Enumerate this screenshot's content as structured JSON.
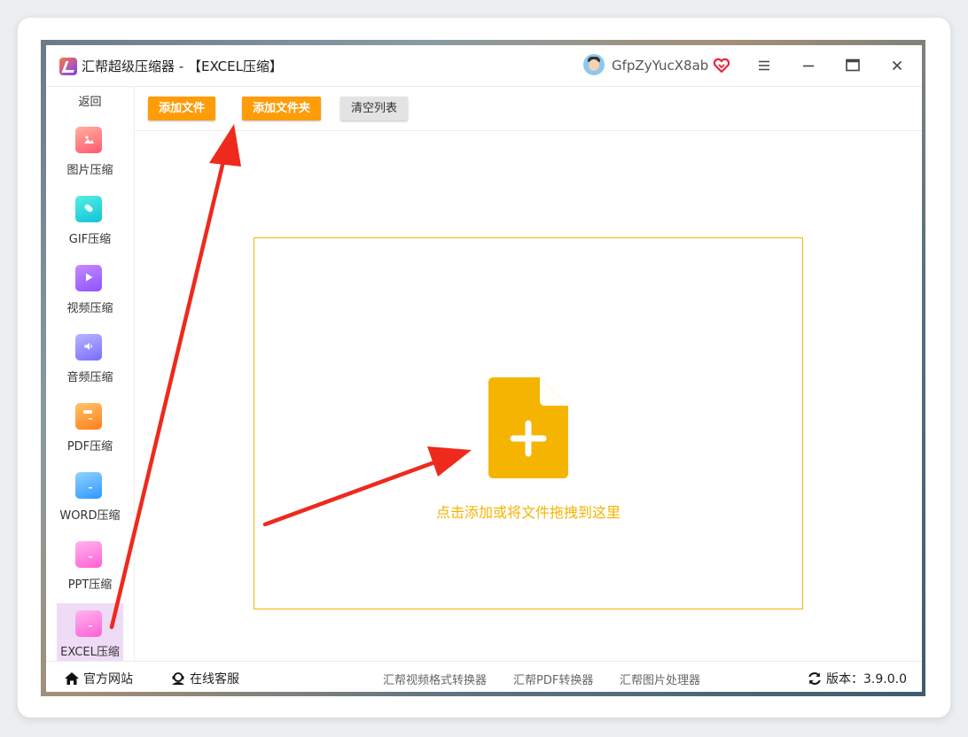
{
  "window": {
    "app_name": "汇帮超级压缩器",
    "title_suffix": " - 【EXCEL压缩】",
    "username": "GfpZyYucX8ab"
  },
  "icons": {
    "vip": "vip-heart-icon",
    "menu": "hamburger-menu-icon",
    "minimize": "minimize-icon",
    "maximize": "maximize-icon",
    "close": "close-icon"
  },
  "sidebar": {
    "back_label": "返回",
    "items": [
      {
        "label": "图片压缩",
        "icon": "image-compress-icon"
      },
      {
        "label": "GIF压缩",
        "icon": "gif-compress-icon"
      },
      {
        "label": "视频压缩",
        "icon": "video-compress-icon"
      },
      {
        "label": "音频压缩",
        "icon": "audio-compress-icon"
      },
      {
        "label": "PDF压缩",
        "icon": "pdf-compress-icon"
      },
      {
        "label": "WORD压缩",
        "icon": "word-compress-icon"
      },
      {
        "label": "PPT压缩",
        "icon": "ppt-compress-icon"
      },
      {
        "label": "EXCEL压缩",
        "icon": "excel-compress-icon",
        "active": true
      }
    ]
  },
  "toolbar": {
    "add_file": "添加文件",
    "add_folder": "添加文件夹",
    "clear_list": "清空列表"
  },
  "dropzone": {
    "hint": "点击添加或将文件拖拽到这里"
  },
  "footer": {
    "official_site": "官方网站",
    "online_service": "在线客服",
    "link_video": "汇帮视频格式转换器",
    "link_pdf": "汇帮PDF转换器",
    "link_image": "汇帮图片处理器",
    "version_label": "版本：3.9.0.0"
  },
  "colors": {
    "accent_orange": "#ff9c0a",
    "drop_border": "#f5b400",
    "active_sidebar": "#eedcf6",
    "annotation_arrow": "#ee2a1c"
  }
}
